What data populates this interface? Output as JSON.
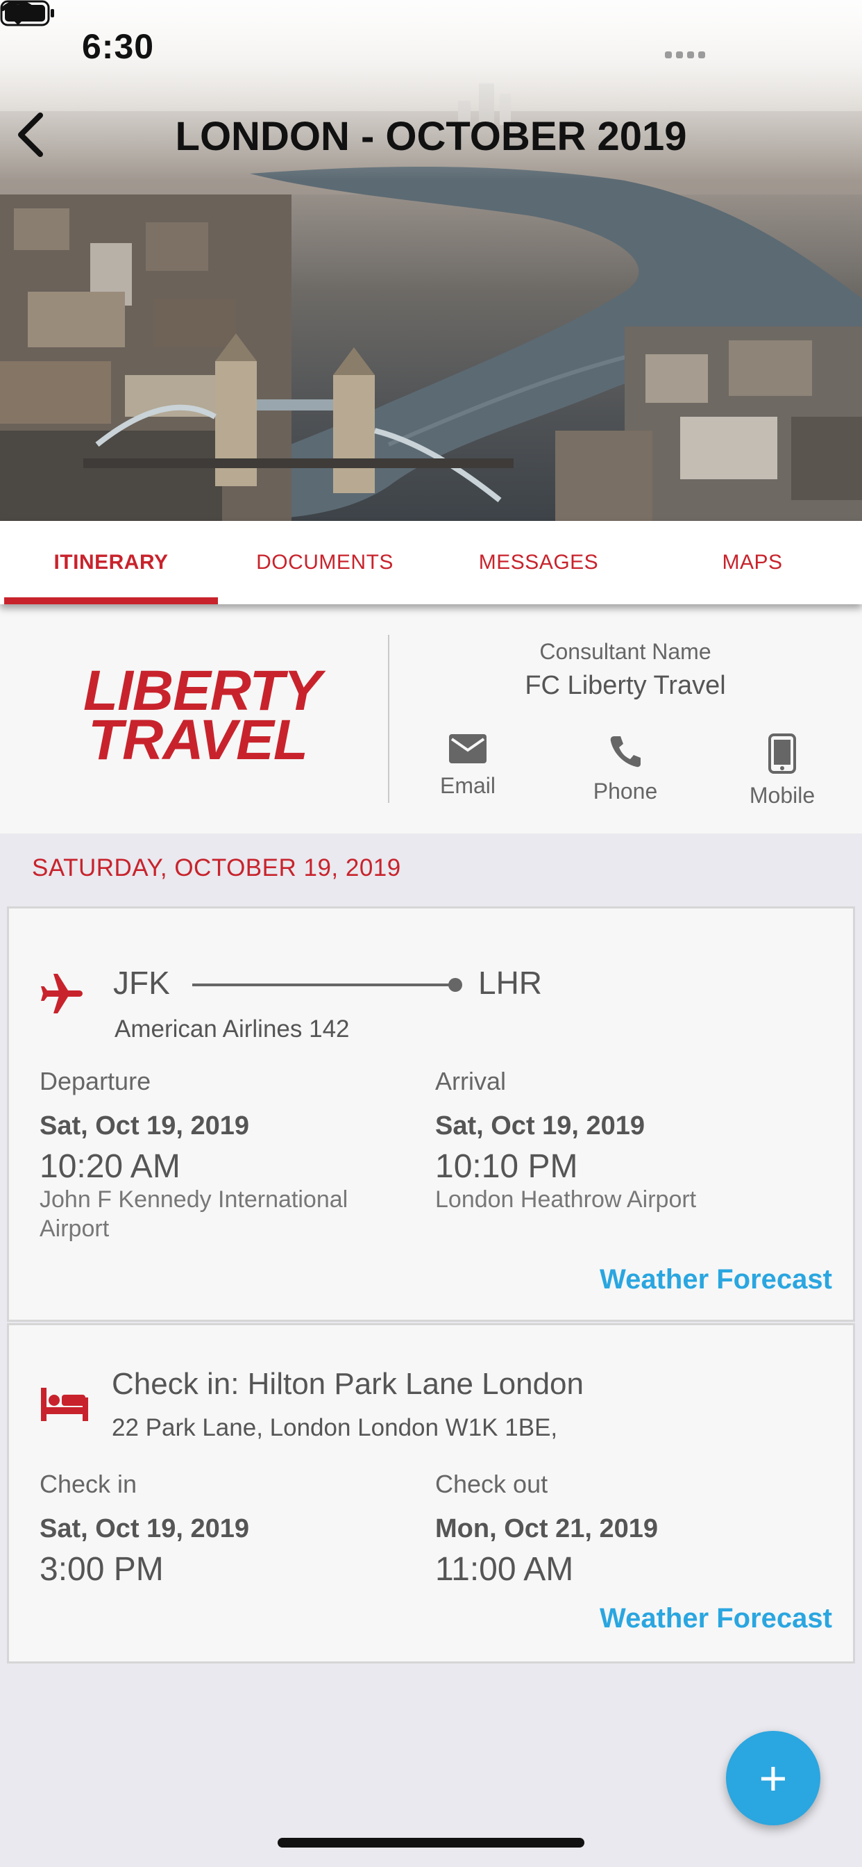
{
  "status_bar": {
    "time": "6:30"
  },
  "header": {
    "title": "LONDON - OCTOBER 2019",
    "back_icon": "chevron-left-icon"
  },
  "tabs": [
    {
      "label": "ITINERARY",
      "active": true
    },
    {
      "label": "DOCUMENTS",
      "active": false
    },
    {
      "label": "MESSAGES",
      "active": false
    },
    {
      "label": "MAPS",
      "active": false
    }
  ],
  "consultant": {
    "logo_line1": "LIBERTY",
    "logo_line2": "TRAVEL",
    "label": "Consultant Name",
    "name": "FC Liberty Travel",
    "actions": [
      {
        "label": "Email",
        "icon": "envelope-icon"
      },
      {
        "label": "Phone",
        "icon": "phone-icon"
      },
      {
        "label": "Mobile",
        "icon": "mobile-phone-icon"
      }
    ]
  },
  "day": {
    "date": "SATURDAY, OCTOBER 19, 2019"
  },
  "flight": {
    "icon": "airplane-icon",
    "from": "JFK",
    "to": "LHR",
    "flight_number": "American Airlines 142",
    "departure": {
      "label": "Departure",
      "date": "Sat, Oct 19, 2019",
      "time": "10:20 AM",
      "place": "John F Kennedy International Airport"
    },
    "arrival": {
      "label": "Arrival",
      "date": "Sat, Oct 19, 2019",
      "time": "10:10 PM",
      "place": "London Heathrow Airport"
    },
    "weather_link": "Weather Forecast"
  },
  "hotel": {
    "icon": "bed-icon",
    "name": "Check in: Hilton Park Lane London",
    "address": "22 Park Lane, London London W1K 1BE,",
    "check_in": {
      "label": "Check in",
      "date": "Sat, Oct 19, 2019",
      "time": "3:00 PM"
    },
    "check_out": {
      "label": "Check out",
      "date": "Mon, Oct 21, 2019",
      "time": "11:00 AM"
    },
    "weather_link": "Weather Forecast"
  },
  "fab": {
    "label": "+",
    "icon": "plus-icon"
  },
  "colors": {
    "brand_red": "#c8232c",
    "link_blue": "#2aa6e0",
    "background": "#e9e9ef",
    "card": "#f7f7f7"
  }
}
